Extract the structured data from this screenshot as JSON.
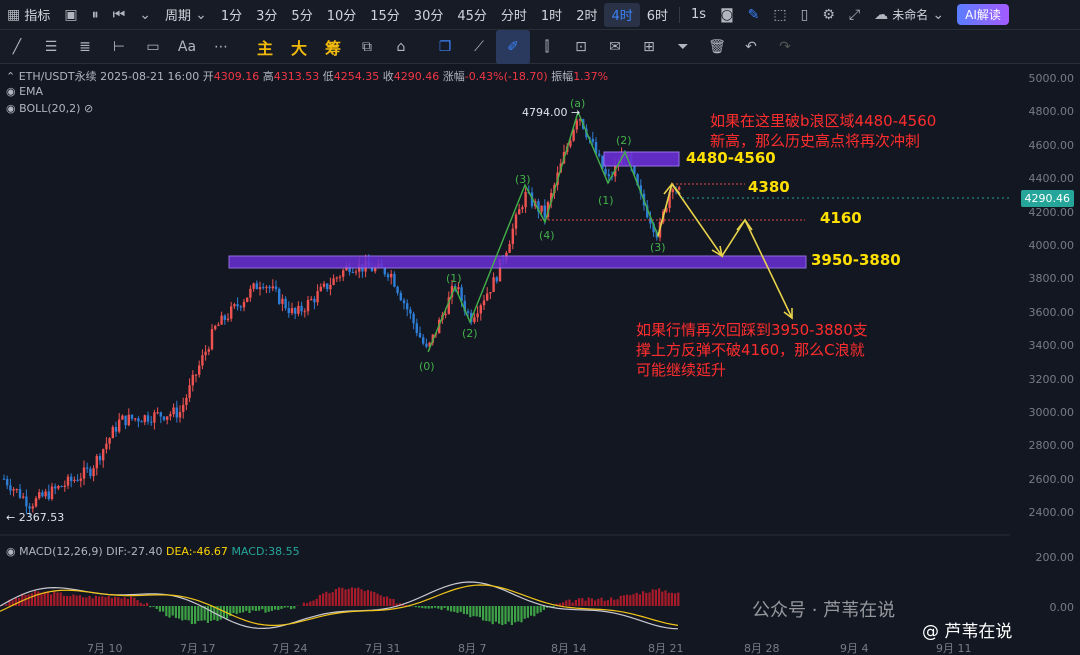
{
  "toolbar": {
    "indicator_label": "指标",
    "period_label": "周期",
    "timeframes": [
      "1分",
      "3分",
      "5分",
      "10分",
      "15分",
      "30分",
      "45分",
      "分时",
      "1时",
      "2时",
      "4时",
      "6时"
    ],
    "active_timeframe": "4时",
    "realtime_label": "1s",
    "layout_name": "未命名",
    "ai_label": "AI解读"
  },
  "drawtools": {
    "main_label": "主",
    "big_label": "大",
    "chip_label": "筹",
    "font_label": "Aa"
  },
  "info": {
    "symbol": "ETH/USDT永续",
    "datetime": "2025-08-21 16:00",
    "open_label": "开",
    "open": "4309.16",
    "high_label": "高",
    "high": "4313.53",
    "low_label": "低",
    "low": "4254.35",
    "close_label": "收",
    "close": "4290.46",
    "change_label": "涨幅",
    "change": "-0.43%(-18.70)",
    "amp_label": "振幅",
    "amp": "1.37%",
    "ema_label": "EMA",
    "boll_label": "BOLL(20,2)"
  },
  "macd": {
    "label": "MACD(12,26,9)",
    "dif": "DIF:-27.40",
    "dea": "DEA:-46.67",
    "macd": "MACD:38.55"
  },
  "price_axis": [
    "5000.00",
    "4800.00",
    "4600.00",
    "4400.00",
    "4200.00",
    "4000.00",
    "3800.00",
    "3600.00",
    "3400.00",
    "3200.00",
    "3000.00",
    "2800.00",
    "2600.00",
    "2400.00"
  ],
  "macd_axis": [
    "200.00",
    "0.00"
  ],
  "current_price": "4290.46",
  "low_marker": "2367.53",
  "high_marker": "4794.00",
  "x_axis": [
    "7月 10",
    "7月 17",
    "7月 24",
    "7月 31",
    "8月 7",
    "8月 14",
    "8月 21",
    "8月 28",
    "9月 4",
    "9月 11"
  ],
  "zones": {
    "upper": "4480-4560",
    "level_4380": "4380",
    "level_4160": "4160",
    "lower": "3950-3880"
  },
  "wave_labels": [
    "(0)",
    "(1)",
    "(2)",
    "(3)",
    "(4)",
    "(a)",
    "(1)",
    "(2)",
    "(3)"
  ],
  "annotations": {
    "top": [
      "如果在这里破b浪区域4480-4560",
      "新高，那么历史高点将再次冲刺"
    ],
    "bottom": [
      "如果行情再次回踩到3950-3880支",
      "撑上方反弹不破4160，那么C浪就",
      "可能继续延升"
    ]
  },
  "watermark": {
    "left": "公众号 · 芦苇在说",
    "right": "@ 芦苇在说"
  },
  "colors": {
    "bg": "#131722",
    "up": "#ef5350",
    "down": "#2e7dd7",
    "zone": "#7b3fe4",
    "wave": "#43b049",
    "accent": "#3b82f6"
  }
}
